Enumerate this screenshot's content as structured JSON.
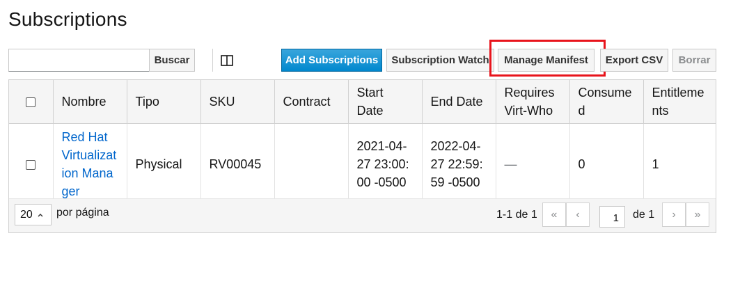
{
  "page": {
    "title": "Subscriptions"
  },
  "toolbar": {
    "search_value": "",
    "search_button": "Buscar",
    "add_label": "Add Subscriptions",
    "watch_label": "Subscription Watch",
    "manifest_label": "Manage Manifest",
    "export_label": "Export CSV",
    "delete_label": "Borrar",
    "highlight_color": "#e8141c"
  },
  "table": {
    "headers": [
      "Nombre",
      "Tipo",
      "SKU",
      "Contract",
      "Start Date",
      "End Date",
      "Requires Virt-Who",
      "Consumed",
      "Entitlements"
    ],
    "header_display": {
      "nombre": "Nombre",
      "tipo": "Tipo",
      "sku": "SKU",
      "contract": "Contract",
      "start_date": "Start Date",
      "end_date": "End Date",
      "virt_who": "Requires Virt-Who",
      "consumed": "Consumed",
      "entitlements": "Entitlements"
    },
    "rows": [
      {
        "name": "Red Hat Virtualization Manager",
        "type": "Physical",
        "sku": "RV00045",
        "contract": "",
        "start_date": "2021-04-27 23:00:00 -0500",
        "end_date": "2022-04-27 22:59:59 -0500",
        "virt_who": "—",
        "consumed": "0",
        "entitlements": "1"
      }
    ]
  },
  "pagination": {
    "per_page": "20",
    "per_page_label": "por página",
    "range": "1-1 de 1",
    "page": "1",
    "of_label": "de 1"
  }
}
